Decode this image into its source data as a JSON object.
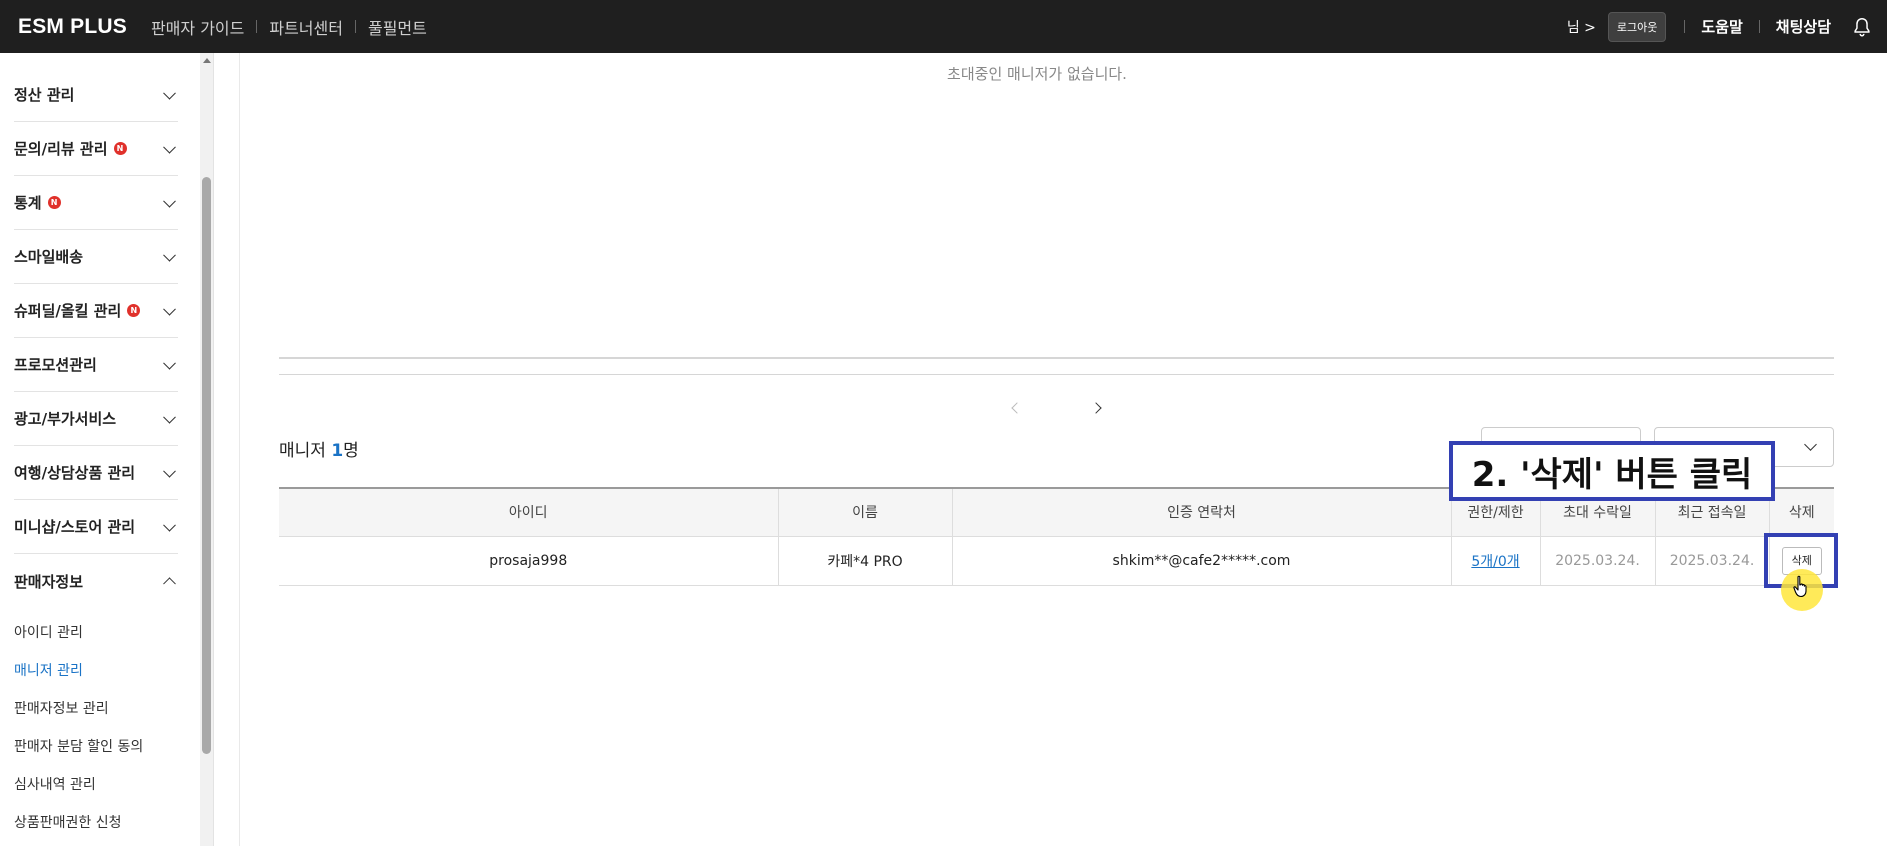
{
  "topbar": {
    "logo": "ESM PLUS",
    "nav": [
      "판매자 가이드",
      "파트너센터",
      "풀필먼트"
    ],
    "user": "님 >",
    "logout": "로그아웃",
    "help": "도움말",
    "chat": "채팅상담"
  },
  "sidebar": {
    "menus": [
      {
        "label": "정산 관리",
        "new": false
      },
      {
        "label": "문의/리뷰 관리",
        "new": true
      },
      {
        "label": "통계",
        "new": true
      },
      {
        "label": "스마일배송",
        "new": false
      },
      {
        "label": "슈퍼딜/올킬 관리",
        "new": true
      },
      {
        "label": "프로모션관리",
        "new": false
      },
      {
        "label": "광고/부가서비스",
        "new": false
      },
      {
        "label": "여행/상담상품 관리",
        "new": false
      },
      {
        "label": "미니샵/스토어 관리",
        "new": false
      },
      {
        "label": "판매자정보",
        "new": false
      }
    ],
    "badge_text": "N",
    "submenu": [
      "아이디 관리",
      "매니저 관리",
      "판매자정보 관리",
      "판매자 분담 할인 동의",
      "심사내역 관리",
      "상품판매권한 신청"
    ],
    "active_sub": "매니저 관리"
  },
  "content": {
    "empty_invite_msg": "초대중인 매니저가 없습니다.",
    "manager_label": "매니저",
    "manager_count": "1",
    "manager_unit": "명",
    "table": {
      "headers": [
        "아이디",
        "이름",
        "인증 연락처",
        "권한/제한",
        "초대 수락일",
        "최근 접속일",
        "삭제"
      ],
      "rows": [
        {
          "id": "prosaja998",
          "name": "카페*4 PRO",
          "contact": "shkim**@cafe2*****.com",
          "permission": "5개/0개",
          "accepted": "2025.03.24.",
          "last_login": "2025.03.24.",
          "delete": "삭제"
        }
      ]
    }
  },
  "annotation": {
    "label": "2. '삭제' 버튼 클릭"
  },
  "colors": {
    "topbar_bg": "#1f1f1f",
    "accent_blue": "#1a73c6",
    "annotation_border": "#3340b3",
    "new_badge": "#e0312b",
    "cursor_highlight": "#ffe63c"
  }
}
